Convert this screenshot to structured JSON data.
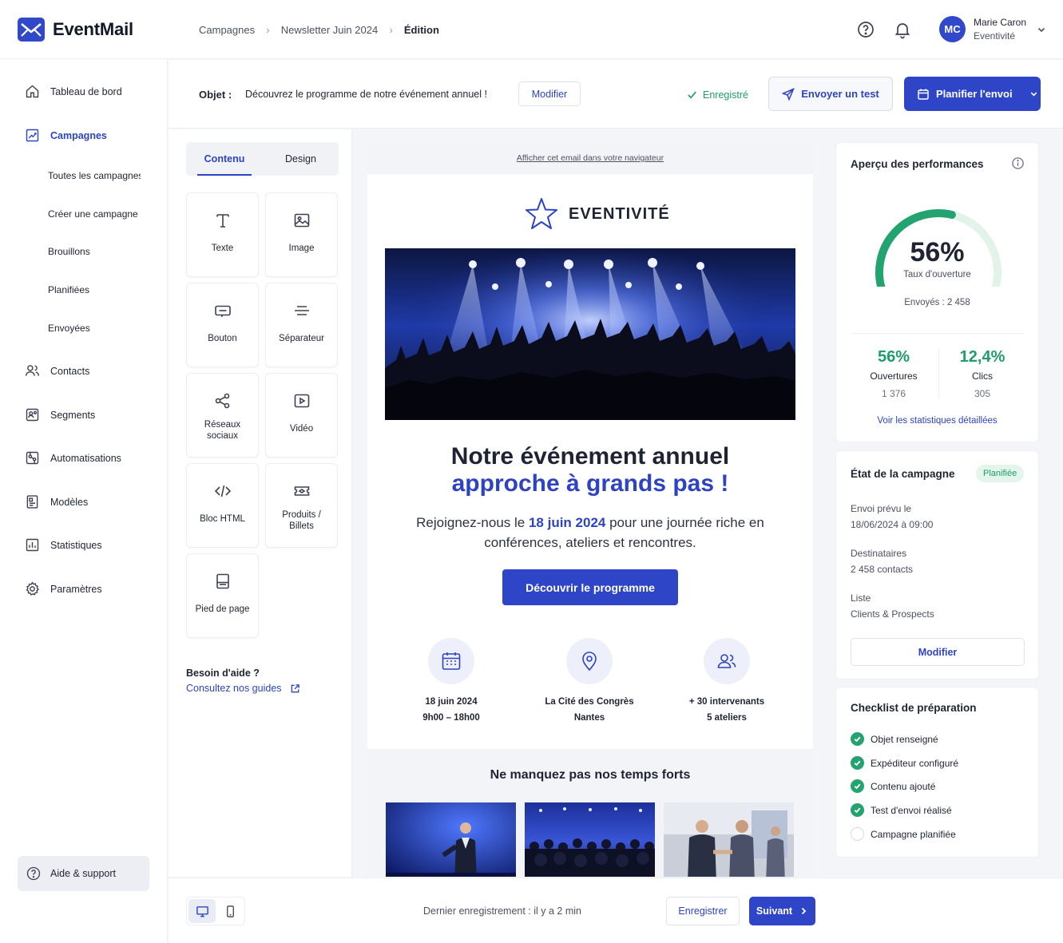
{
  "app": {
    "name": "EventMail"
  },
  "breadcrumb": [
    "Campagnes",
    "Newsletter Juin 2024",
    "Édition"
  ],
  "user": {
    "initials": "MC",
    "name": "Marie Caron",
    "org": "Eventivité"
  },
  "sidebar": {
    "items": [
      {
        "label": "Tableau de bord",
        "icon": "home-icon"
      },
      {
        "label": "Campagnes",
        "icon": "campaign-chart-icon",
        "active": true
      },
      {
        "label": "Contacts",
        "icon": "users-icon"
      },
      {
        "label": "Segments",
        "icon": "segments-icon"
      },
      {
        "label": "Automatisations",
        "icon": "automation-icon"
      },
      {
        "label": "Modèles",
        "icon": "templates-icon"
      },
      {
        "label": "Statistiques",
        "icon": "stats-icon"
      },
      {
        "label": "Paramètres",
        "icon": "gear-icon"
      }
    ],
    "sub_items": [
      "Toutes les campagnes",
      "Créer une campagne",
      "Brouillons",
      "Planifiées",
      "Envoyées"
    ],
    "help": "Aide & support"
  },
  "subject": {
    "label": "Objet :",
    "text": "Découvrez le programme de notre événement annuel !",
    "edit": "Modifier",
    "saved": "Enregistré",
    "send_test": "Envoyer un test",
    "schedule": "Planifier l'envoi"
  },
  "blocks": {
    "tabs": [
      "Contenu",
      "Design"
    ],
    "items": [
      {
        "label": "Texte",
        "icon": "text-icon"
      },
      {
        "label": "Image",
        "icon": "image-icon"
      },
      {
        "label": "Bouton",
        "icon": "button-icon"
      },
      {
        "label": "Séparateur",
        "icon": "separator-icon"
      },
      {
        "label": "Réseaux sociaux",
        "icon": "share-icon"
      },
      {
        "label": "Vidéo",
        "icon": "video-icon"
      },
      {
        "label": "Bloc HTML",
        "icon": "code-icon"
      },
      {
        "label": "Produits / Billets",
        "icon": "ticket-icon"
      },
      {
        "label": "Pied de page",
        "icon": "footer-icon"
      }
    ],
    "help_title": "Besoin d'aide ?",
    "help_link": "Consultez nos guides"
  },
  "email": {
    "view_in_browser": "Afficher cet email dans votre navigateur",
    "brand": "EVENTIVITÉ",
    "title_line1": "Notre événement annuel",
    "title_line2": "approche à grands pas !",
    "lead_before": "Rejoignez-nous le ",
    "lead_date": "18 juin 2024",
    "lead_after": " pour une journée riche en conférences, ateliers et rencontres.",
    "cta": "Découvrir le programme",
    "features": [
      {
        "line1": "18 juin 2024",
        "line2": "9h00 – 18h00",
        "icon": "calendar-icon"
      },
      {
        "line1": "La Cité des Congrès",
        "line2": "Nantes",
        "icon": "map-pin-icon"
      },
      {
        "line1": "+ 30 intervenants",
        "line2": "5 ateliers",
        "icon": "people-icon"
      }
    ],
    "highlights_title": "Ne manquez pas nos temps forts"
  },
  "performance": {
    "title": "Aperçu des performances",
    "open_rate": "56%",
    "open_rate_fraction": 0.56,
    "open_rate_label": "Taux d'ouverture",
    "sent": "Envoyés : 2 458",
    "metrics": [
      {
        "value": "56%",
        "label": "Ouvertures",
        "count": "1 376"
      },
      {
        "value": "12,4%",
        "label": "Clics",
        "count": "305"
      }
    ],
    "link": "Voir les statistiques détaillées"
  },
  "status": {
    "title": "État de la campagne",
    "badge": "Planifiée",
    "send_label": "Envoi prévu le",
    "send_value": "18/06/2024 à 09:00",
    "recipients_label": "Destinataires",
    "recipients_value": "2 458 contacts",
    "list_label": "Liste",
    "list_value": "Clients & Prospects",
    "edit": "Modifier"
  },
  "checklist": {
    "title": "Checklist de préparation",
    "items": [
      {
        "label": "Objet renseigné",
        "done": true
      },
      {
        "label": "Expéditeur configuré",
        "done": true
      },
      {
        "label": "Contenu ajouté",
        "done": true
      },
      {
        "label": "Test d'envoi réalisé",
        "done": true
      },
      {
        "label": "Campagne planifiée",
        "done": false
      }
    ]
  },
  "footer": {
    "last_save": "Dernier enregistrement : il y a 2 min",
    "save": "Enregistrer",
    "next": "Suivant"
  },
  "colors": {
    "primary": "#2f45c8",
    "success": "#22a36f",
    "background": "#f4f5f8"
  }
}
